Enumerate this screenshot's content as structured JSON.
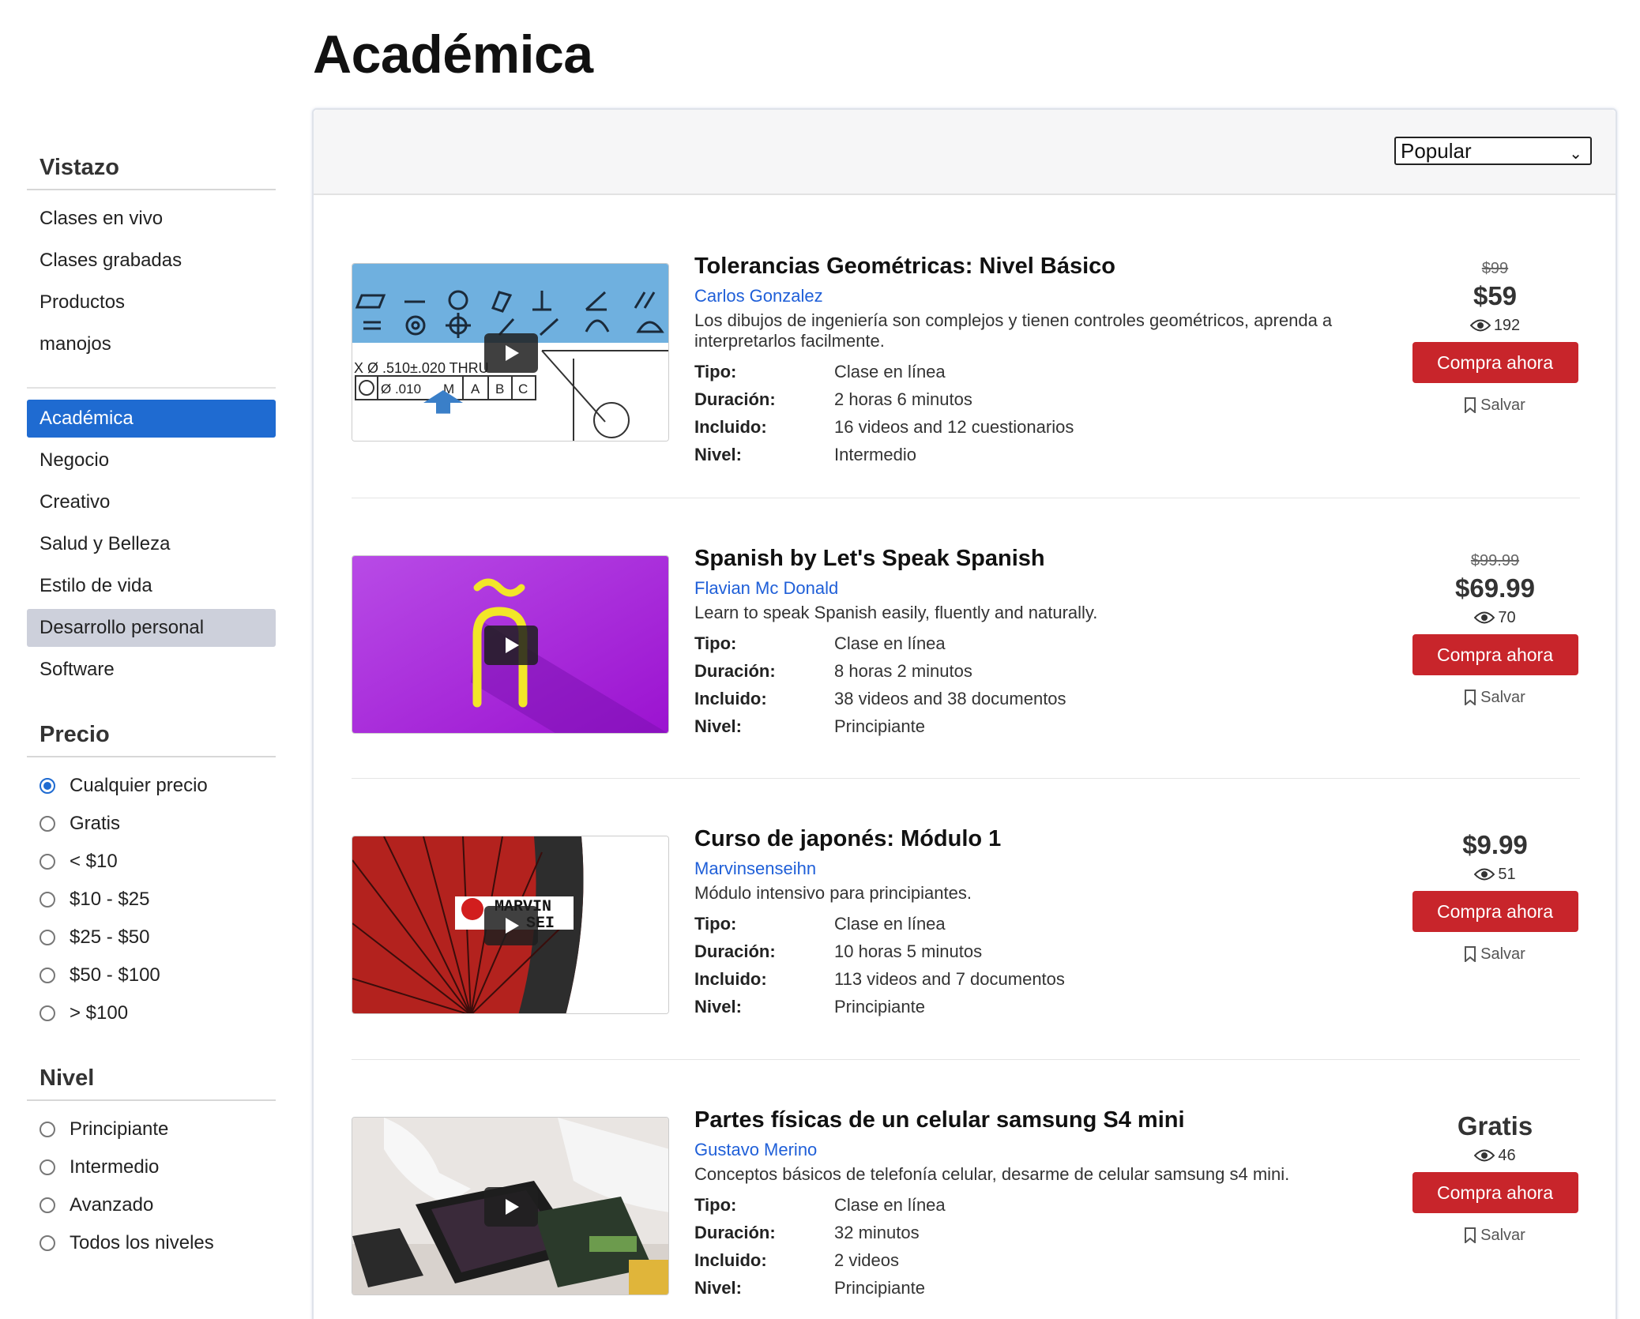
{
  "page_title": "Académica",
  "sidebar": {
    "overview_title": "Vistazo",
    "overview_items": [
      {
        "label": "Clases en vivo"
      },
      {
        "label": "Clases grabadas"
      },
      {
        "label": "Productos"
      },
      {
        "label": "manojos"
      }
    ],
    "category_items": [
      {
        "label": "Académica",
        "state": "active"
      },
      {
        "label": "Negocio"
      },
      {
        "label": "Creativo"
      },
      {
        "label": "Salud y Belleza"
      },
      {
        "label": "Estilo de vida"
      },
      {
        "label": "Desarrollo personal",
        "state": "hover"
      },
      {
        "label": "Software"
      }
    ],
    "price_title": "Precio",
    "price_options": [
      {
        "label": "Cualquier precio",
        "checked": true
      },
      {
        "label": "Gratis"
      },
      {
        "label": "< $10"
      },
      {
        "label": "$10 - $25"
      },
      {
        "label": "$25 - $50"
      },
      {
        "label": "$50 - $100"
      },
      {
        "label": "> $100"
      }
    ],
    "level_title": "Nivel",
    "level_options": [
      {
        "label": "Principiante"
      },
      {
        "label": "Intermedio"
      },
      {
        "label": "Avanzado"
      },
      {
        "label": "Todos los niveles"
      }
    ]
  },
  "sort": {
    "selected": "Popular"
  },
  "spec_labels": {
    "type": "Tipo:",
    "duration": "Duración:",
    "included": "Incluido:",
    "level": "Nivel:"
  },
  "buy_label": "Compra ahora",
  "save_label": "Salvar",
  "courses": [
    {
      "title": "Tolerancias Geométricas: Nivel Básico",
      "author": "Carlos Gonzalez",
      "description": "Los dibujos de ingeniería son complejos y tienen controles geométricos, aprenda a interpretarlos facilmente.",
      "type": "Clase en línea",
      "duration": "2 horas 6 minutos",
      "included": "16 videos and 12 cuestionarios",
      "level": "Intermedio",
      "old_price": "$99",
      "price": "$59",
      "views": "192",
      "thumb": "gdt"
    },
    {
      "title": "Spanish by Let's Speak Spanish",
      "author": "Flavian Mc Donald",
      "description": "Learn to speak Spanish easily, fluently and naturally.",
      "type": "Clase en línea",
      "duration": "8 horas 2 minutos",
      "included": "38 videos and 38 documentos",
      "level": "Principiante",
      "old_price": "$99.99",
      "price": "$69.99",
      "views": "70",
      "thumb": "spanish"
    },
    {
      "title": "Curso de japonés: Módulo 1",
      "author": "Marvinsenseihn",
      "description": "Módulo intensivo para principiantes.",
      "type": "Clase en línea",
      "duration": "10 horas 5 minutos",
      "included": "113 videos and 7 documentos",
      "level": "Principiante",
      "old_price": "",
      "price": "$9.99",
      "views": "51",
      "thumb": "japanese",
      "thumb_text": [
        "MARVIN",
        "SEI"
      ]
    },
    {
      "title": "Partes físicas de un celular samsung S4 mini",
      "author": "Gustavo Merino",
      "description": "Conceptos básicos de telefonía celular, desarme de celular samsung s4 mini.",
      "type": "Clase en línea",
      "duration": "32 minutos",
      "included": "2 videos",
      "level": "Principiante",
      "old_price": "",
      "price": "Gratis",
      "views": "46",
      "thumb": "phone"
    }
  ],
  "gdt_thumb": {
    "annotation": "X Ø .510±.020 THRU",
    "frame_cells": [
      "Ø .010",
      "M",
      "A",
      "B",
      "C"
    ]
  },
  "colors": {
    "accent": "#1f6bd1",
    "buy": "#c8252b",
    "link": "#1f5fd8"
  }
}
